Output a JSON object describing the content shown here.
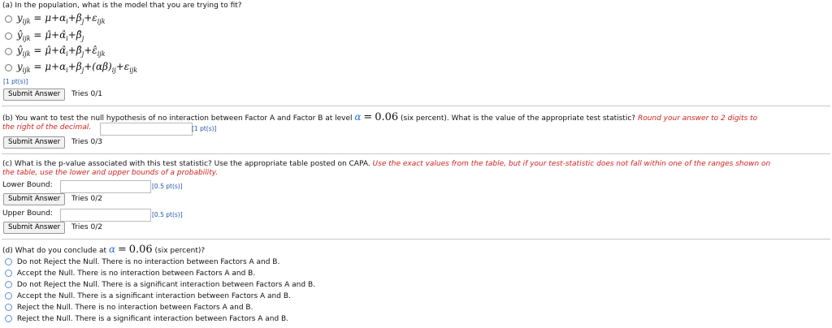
{
  "part_a": {
    "question": "(a) In the population, what is the model that you are trying to fit?",
    "options": [
      "y_ijk = μ + α_i + β_j + ε_ijk",
      "ŷ_ijk = μ̂ + α̂_i + β̂_j",
      "ŷ_ijk = μ̂ + α̂_i + β̂_j + ε̂_ijk",
      "y_ijk = μ + α_i + β_j + (αβ)_ij + ε_ijk"
    ],
    "points": "[1 pt(s)]",
    "submit_label": "Submit Answer",
    "tries": "Tries 0/1"
  },
  "part_b": {
    "question_prefix": "(b) You want to test the null hypothesis of no interaction between Factor A and Factor B at level",
    "alpha_symbol": "α",
    "equals": "=",
    "alpha_value": "0.06",
    "question_suffix": "(six percent). What is the value of the appropriate test statistic?",
    "instruction_part1": "Round your answer to 2 digits to",
    "instruction_part2": "the right of the decimal.",
    "answer_value": "",
    "points": "[1 pt(s)]",
    "submit_label": "Submit Answer",
    "tries": "Tries 0/3"
  },
  "part_c": {
    "question": "(c) What is the p-value associated with this test statistic? Use the appropriate table posted on CAPA.",
    "instruction_part1": "Use the exact values from the table, but if your test-statistic does not fall within one of the ranges shown on",
    "instruction_part2": "the table, use the lower and upper bounds of a probability.",
    "lower_label": "Lower Bound:",
    "lower_value": "",
    "lower_points": "[0.5 pt(s)]",
    "upper_label": "Upper Bound:",
    "upper_value": "",
    "upper_points": "[0.5 pt(s)]",
    "submit_label": "Submit Answer",
    "lower_tries": "Tries 0/2",
    "upper_tries": "Tries 0/2"
  },
  "part_d": {
    "question_prefix": "(d) What do you conclude at",
    "alpha_symbol": "α",
    "equals": "=",
    "alpha_value": "0.06",
    "question_suffix": "(six percent)?",
    "options": [
      "Do not Reject the Null. There is no interaction between Factors A and B.",
      "Accept the Null. There is no interaction between Factors A and B.",
      "Do not Reject the Null. There is a significant interaction between Factors A and B.",
      "Accept the Null. There is a significant interaction between Factors A and B.",
      "Reject the Null. There is no interaction between Factors A and B.",
      "Reject the Null. There is a significant interaction between Factors A and B."
    ]
  },
  "colors": {
    "instruction_red": "#d0231f",
    "points_blue": "#2255aa",
    "radio_blue": "#5a8fd6"
  }
}
